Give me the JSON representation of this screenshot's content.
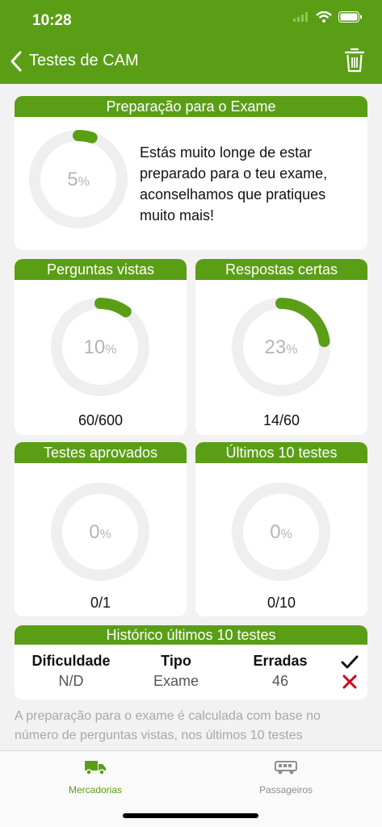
{
  "status": {
    "time": "10:28"
  },
  "nav": {
    "back_title": "Testes de CAM"
  },
  "prep": {
    "title": "Preparação para o Exame",
    "percent": 5,
    "percent_text": "5",
    "message": "Estás muito longe de estar preparado para o teu exame, aconselhamos que pratiques muito mais!"
  },
  "cards": [
    {
      "title": "Perguntas vistas",
      "percent": 10,
      "percent_text": "10",
      "count": "60/600"
    },
    {
      "title": "Respostas certas",
      "percent": 23,
      "percent_text": "23",
      "count": "14/60"
    },
    {
      "title": "Testes aprovados",
      "percent": 0,
      "percent_text": "0",
      "count": "0/1"
    },
    {
      "title": "Últimos 10 testes",
      "percent": 0,
      "percent_text": "0",
      "count": "0/10"
    }
  ],
  "percent_sign": "%",
  "history": {
    "title": "Histórico últimos 10 testes",
    "col_difficulty": "Dificuldade",
    "val_difficulty": "N/D",
    "col_type": "Tipo",
    "val_type": "Exame",
    "col_wrong": "Erradas",
    "val_wrong": "46"
  },
  "footnote": "A preparação para o exame é calculada com base no número de perguntas vistas, nos últimos 10 testes",
  "tabs": [
    {
      "label": "Mercadorias",
      "icon": "truck-icon",
      "active": true
    },
    {
      "label": "Passageiros",
      "icon": "bus-icon",
      "active": false
    }
  ],
  "colors": {
    "accent": "#5a9e16",
    "ring_bg": "#efefef",
    "error": "#d0021b"
  }
}
